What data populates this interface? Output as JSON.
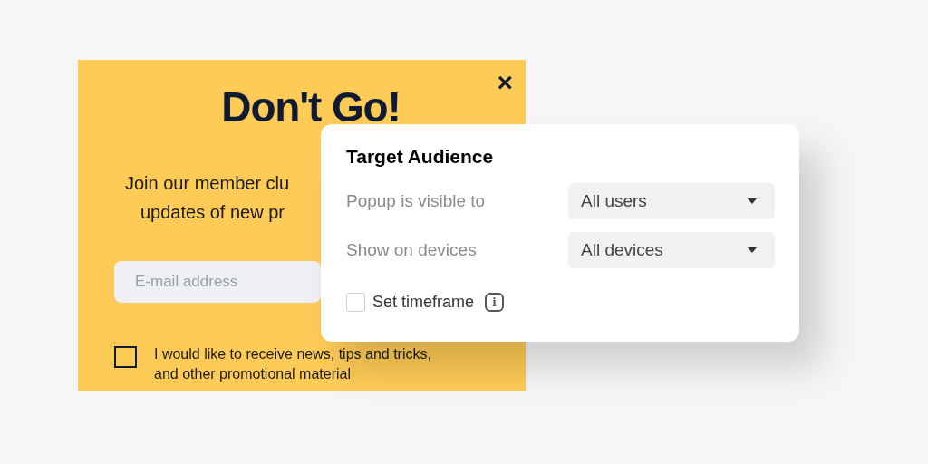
{
  "popup": {
    "close": "×",
    "title": "Don't Go!",
    "intro_lines": [
      "Join our member clu",
      "updates of new pr"
    ],
    "email": {
      "placeholder": "E-mail address"
    },
    "consent": {
      "checked": false,
      "label": "I would like to receive news, tips and tricks,",
      "label_line2": "and other promotional material"
    }
  },
  "settings": {
    "title": "Target Audience",
    "rows": [
      {
        "label": "Popup is visible to",
        "value": "All users"
      },
      {
        "label": "Show on devices",
        "value": "All devices"
      }
    ],
    "timeframe": {
      "checked": false,
      "label": "Set timeframe",
      "info": "i"
    }
  }
}
